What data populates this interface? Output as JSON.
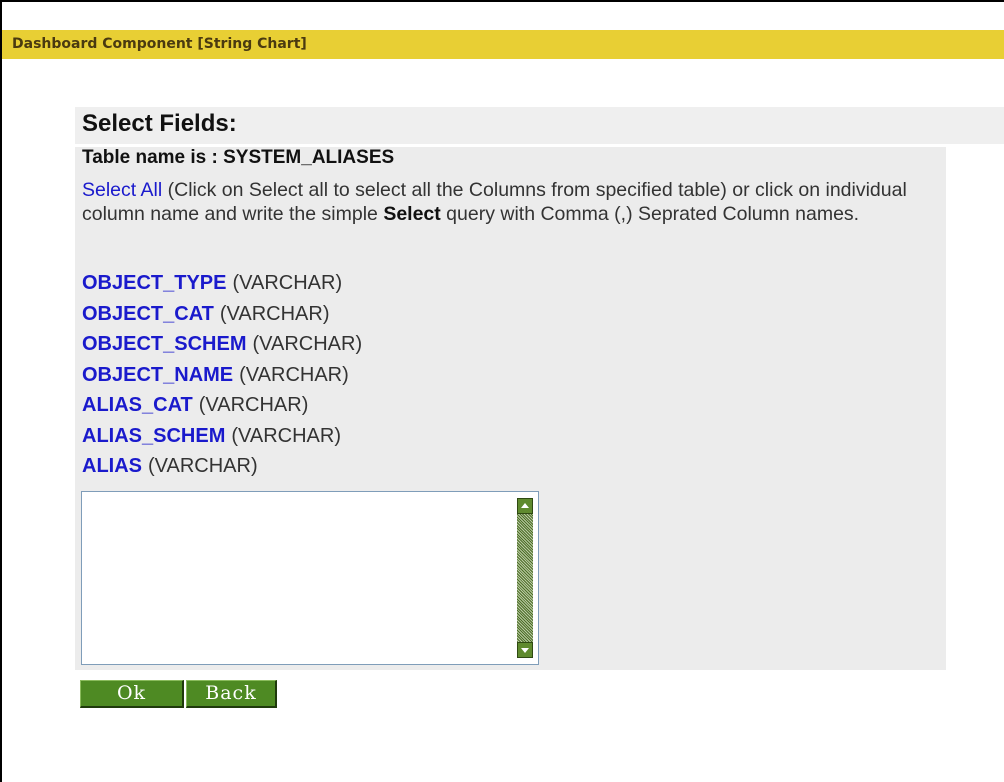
{
  "title_bar": {
    "text": "Dashboard Component [String Chart]"
  },
  "heading": "Select Fields:",
  "table_line": "Table name is : SYSTEM_ALIASES",
  "instructions": {
    "select_all_link": "Select All",
    "text_part1": " (Click on Select all to select all the Columns from specified table) or click on individual column name and write the simple ",
    "select_keyword": "Select",
    "text_part2": " query with Comma (,) Seprated Column names."
  },
  "columns": [
    {
      "name": "OBJECT_TYPE",
      "type": "(VARCHAR)"
    },
    {
      "name": "OBJECT_CAT",
      "type": "(VARCHAR)"
    },
    {
      "name": "OBJECT_SCHEM",
      "type": "(VARCHAR)"
    },
    {
      "name": "OBJECT_NAME",
      "type": "(VARCHAR)"
    },
    {
      "name": "ALIAS_CAT",
      "type": "(VARCHAR)"
    },
    {
      "name": "ALIAS_SCHEM",
      "type": "(VARCHAR)"
    },
    {
      "name": "ALIAS",
      "type": "(VARCHAR)"
    }
  ],
  "query_box": {
    "value": ""
  },
  "buttons": {
    "ok": "Ok",
    "back": "Back"
  },
  "colors": {
    "title_bar": "#e8cf34",
    "link": "#1a1acc",
    "button": "#4e8a23",
    "panel": "#ececec"
  }
}
